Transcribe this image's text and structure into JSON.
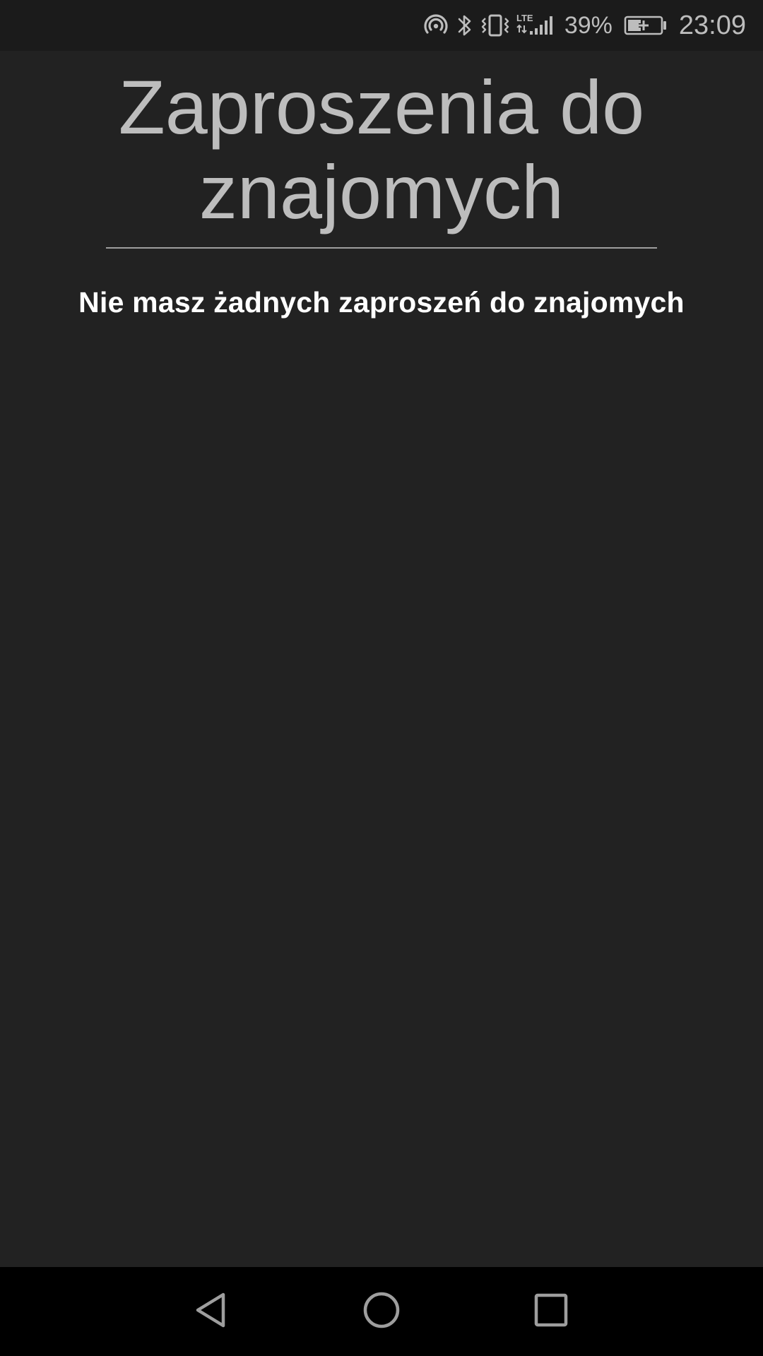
{
  "status_bar": {
    "battery_percent": "39%",
    "time": "23:09",
    "icons": [
      "hotspot-icon",
      "bluetooth-icon",
      "vibrate-icon",
      "lte-signal-icon",
      "battery-charging-icon"
    ]
  },
  "page": {
    "title": "Zaproszenia do znajomych",
    "empty_message": "Nie masz żadnych zaproszeń do znajomych"
  },
  "nav_bar": {
    "icons": [
      "back-icon",
      "home-icon",
      "recents-icon"
    ]
  },
  "colors": {
    "background": "#222222",
    "status_bar": "#1b1b1b",
    "title_text": "#bdbdbd",
    "message_text": "#ffffff",
    "nav_bar": "#000000"
  }
}
